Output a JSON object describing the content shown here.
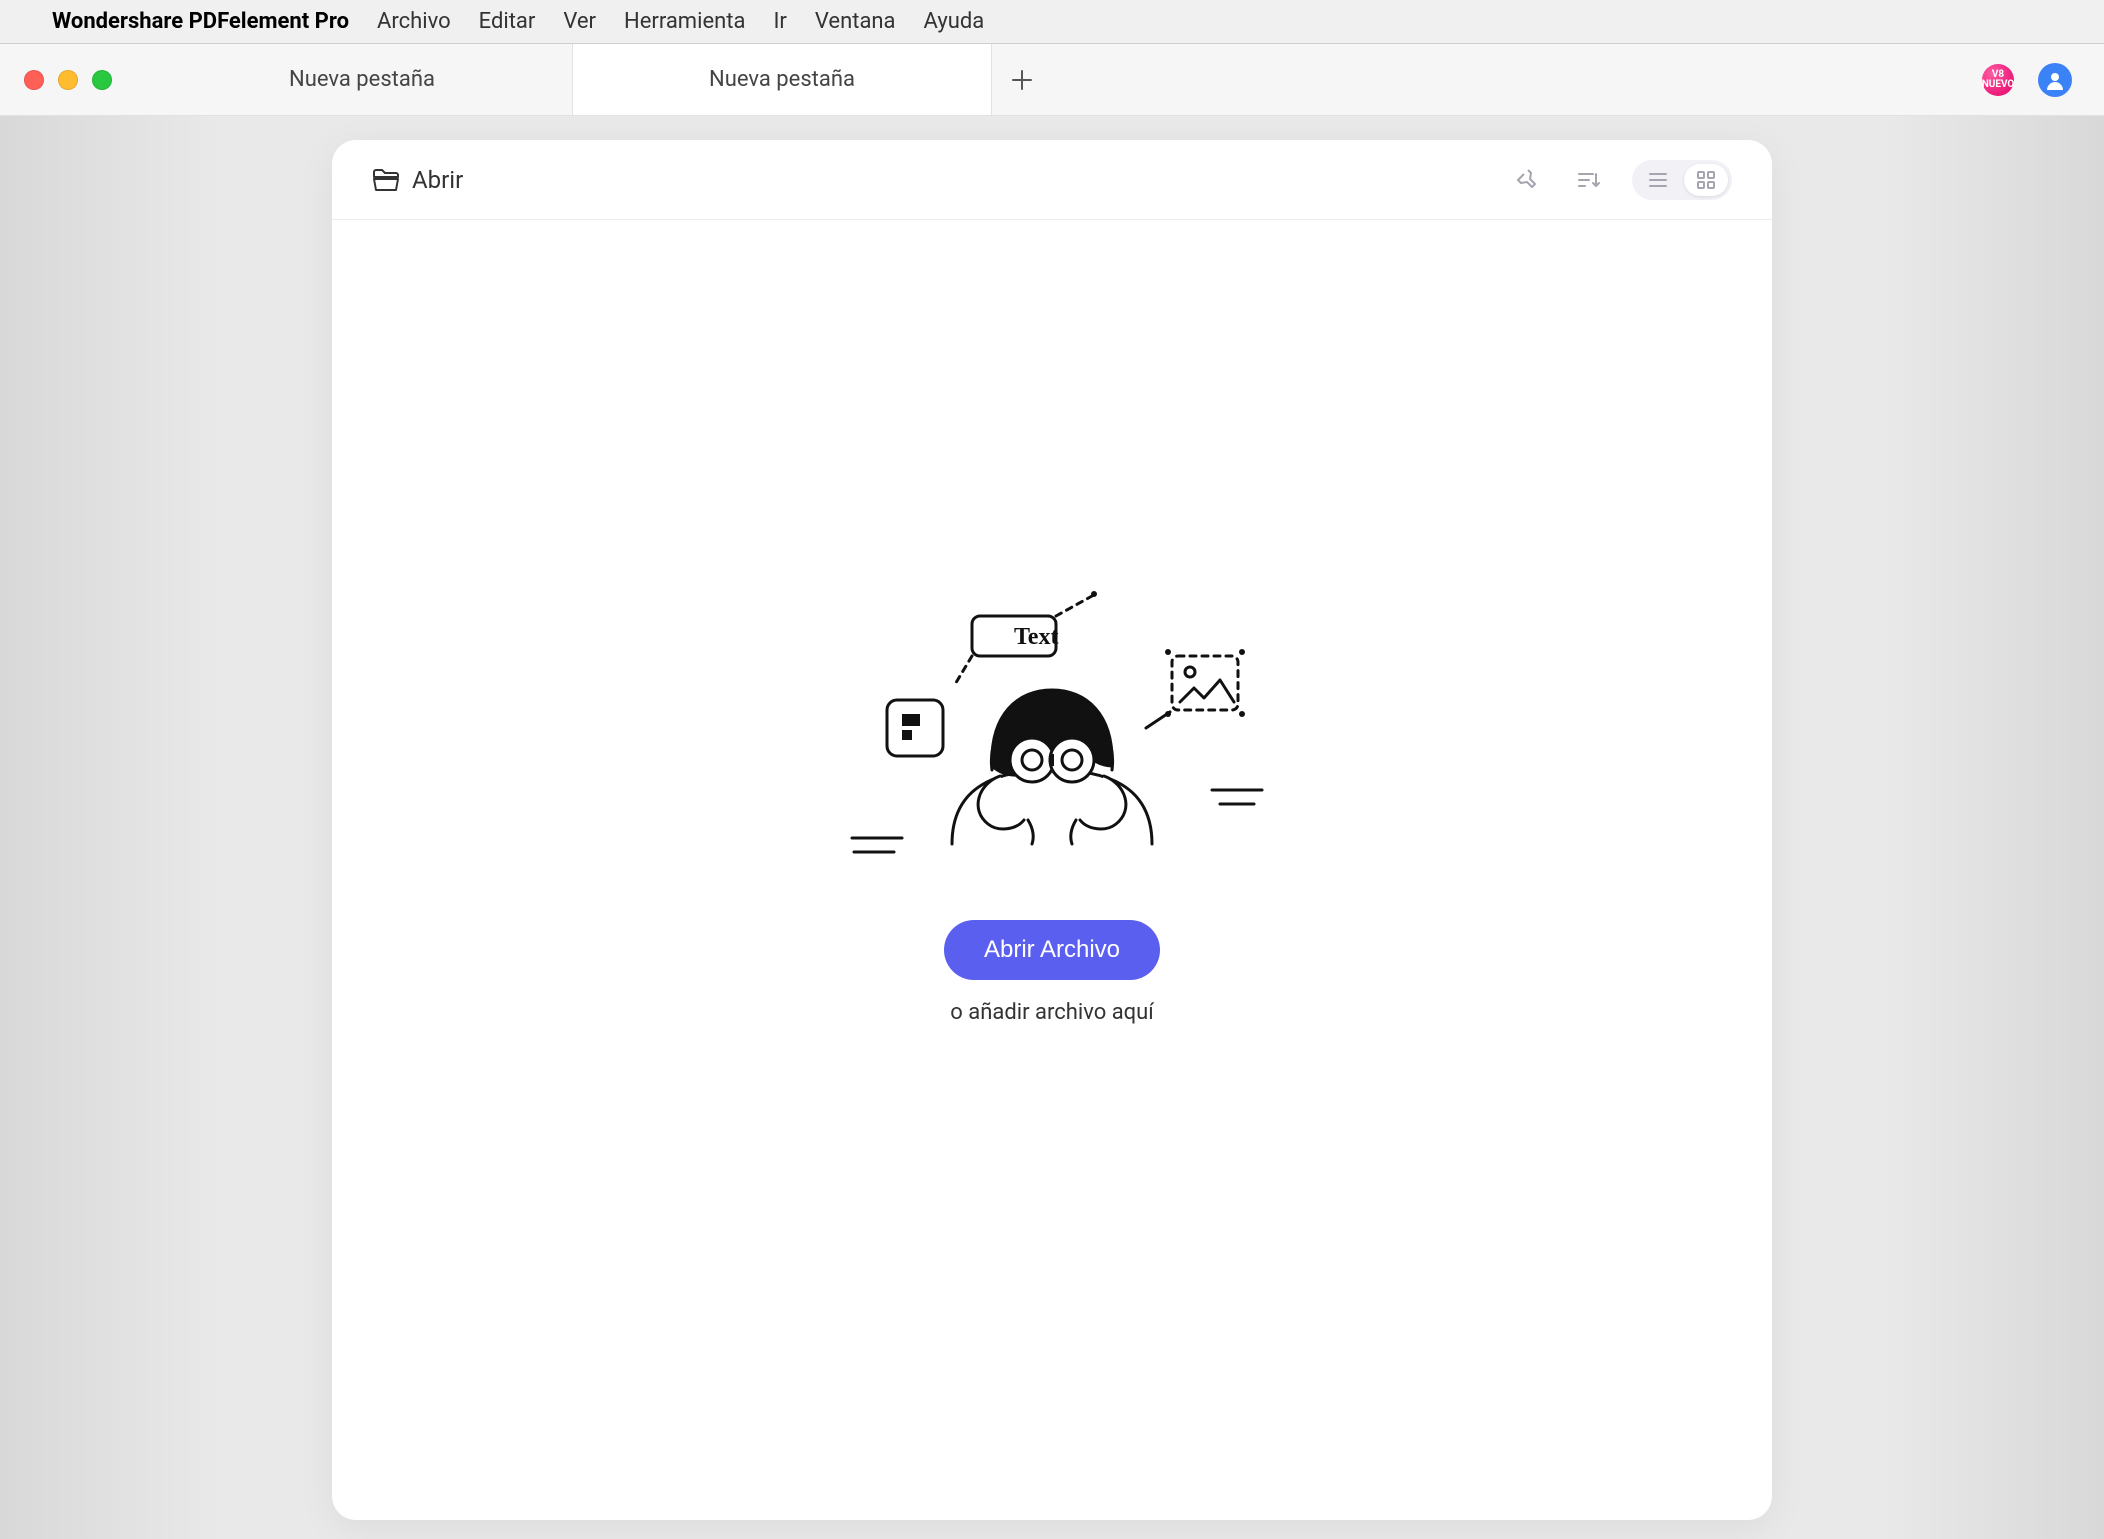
{
  "menubar": {
    "app_name": "Wondershare PDFelement Pro",
    "items": [
      "Archivo",
      "Editar",
      "Ver",
      "Herramienta",
      "Ir",
      "Ventana",
      "Ayuda"
    ]
  },
  "window": {
    "tabs": [
      {
        "label": "Nueva pestaña",
        "active": false
      },
      {
        "label": "Nueva pestaña",
        "active": true
      }
    ],
    "new_tab_icon": "plus-icon",
    "badge_label": "V8 NUEVO",
    "avatar_icon": "user-icon"
  },
  "panel": {
    "open_label": "Abrir",
    "toolbar_icons": {
      "pin": "pin-icon",
      "sort": "sort-icon",
      "view_list": "list-view-icon",
      "view_grid": "grid-view-icon"
    },
    "grid_view_active": true
  },
  "empty_state": {
    "illustration_text": "Text",
    "primary_button": "Abrir Archivo",
    "hint": "o añadir archivo aquí"
  },
  "colors": {
    "accent": "#5b5fef",
    "badge": "#e4006a",
    "avatar": "#3b82f6"
  }
}
